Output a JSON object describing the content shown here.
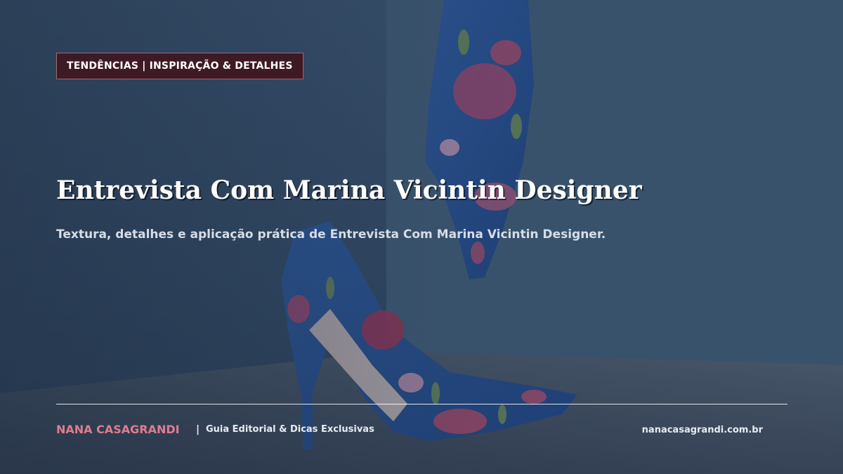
{
  "header": {
    "category": "TENDÊNCIAS | INSPIRAÇÃO & DETALHES"
  },
  "main": {
    "title": "Entrevista Com Marina Vicintin Designer",
    "subtitle": "Textura, detalhes e aplicação prática de Entrevista Com Marina Vicintin Designer."
  },
  "footer": {
    "brand": "NANA CASAGRANDI",
    "separator": "|",
    "tagline": "Guia Editorial & Dicas Exclusivas",
    "url": "nanacasagrandi.com.br"
  },
  "colors": {
    "badge_bg": "#3e1a24",
    "brand_accent": "#e07d8e",
    "background": "#3a5170"
  },
  "hero_image": {
    "subject": "floral-blue-high-heel-shoes"
  }
}
